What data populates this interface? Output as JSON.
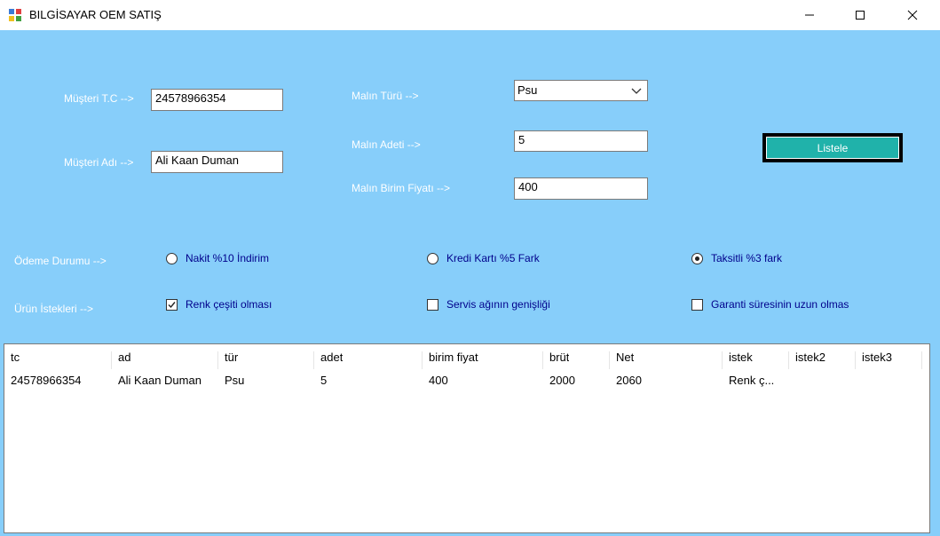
{
  "window": {
    "title": "BILGİSAYAR OEM SATIŞ"
  },
  "form": {
    "musteri_tc_label": "Müşteri T.C -->",
    "musteri_tc_value": "24578966354",
    "musteri_adi_label": "Müşteri Adı -->",
    "musteri_adi_value": "Ali Kaan Duman",
    "malin_turu_label": "Malın Türü -->",
    "malin_turu_value": "Psu",
    "malin_adeti_label": "Malın Adeti -->",
    "malin_adeti_value": "5",
    "birim_fiyat_label": "Malın Birim Fiyatı -->",
    "birim_fiyat_value": "400",
    "listele_label": "Listele"
  },
  "odeme": {
    "label": "Ödeme Durumu -->",
    "options": [
      {
        "label": "Nakit %10 İndirim",
        "selected": false
      },
      {
        "label": "Kredi Kartı %5 Fark",
        "selected": false
      },
      {
        "label": "Taksitli %3 fark",
        "selected": true
      }
    ]
  },
  "istekler": {
    "label": "Ürün İstekleri -->",
    "options": [
      {
        "label": "Renk çeşiti olması",
        "checked": true
      },
      {
        "label": "Servis ağının genişliği",
        "checked": false
      },
      {
        "label": "Garanti süresinin uzun olmas",
        "checked": false
      }
    ]
  },
  "grid": {
    "columns": [
      "tc",
      "ad",
      "tür",
      "adet",
      "birim fiyat",
      "brüt",
      "Net",
      "istek",
      "istek2",
      "istek3"
    ],
    "rows": [
      [
        "24578966354",
        "Ali Kaan Duman",
        "Psu",
        "5",
        "400",
        "2000",
        "2060",
        "Renk ç...",
        "",
        ""
      ]
    ]
  }
}
